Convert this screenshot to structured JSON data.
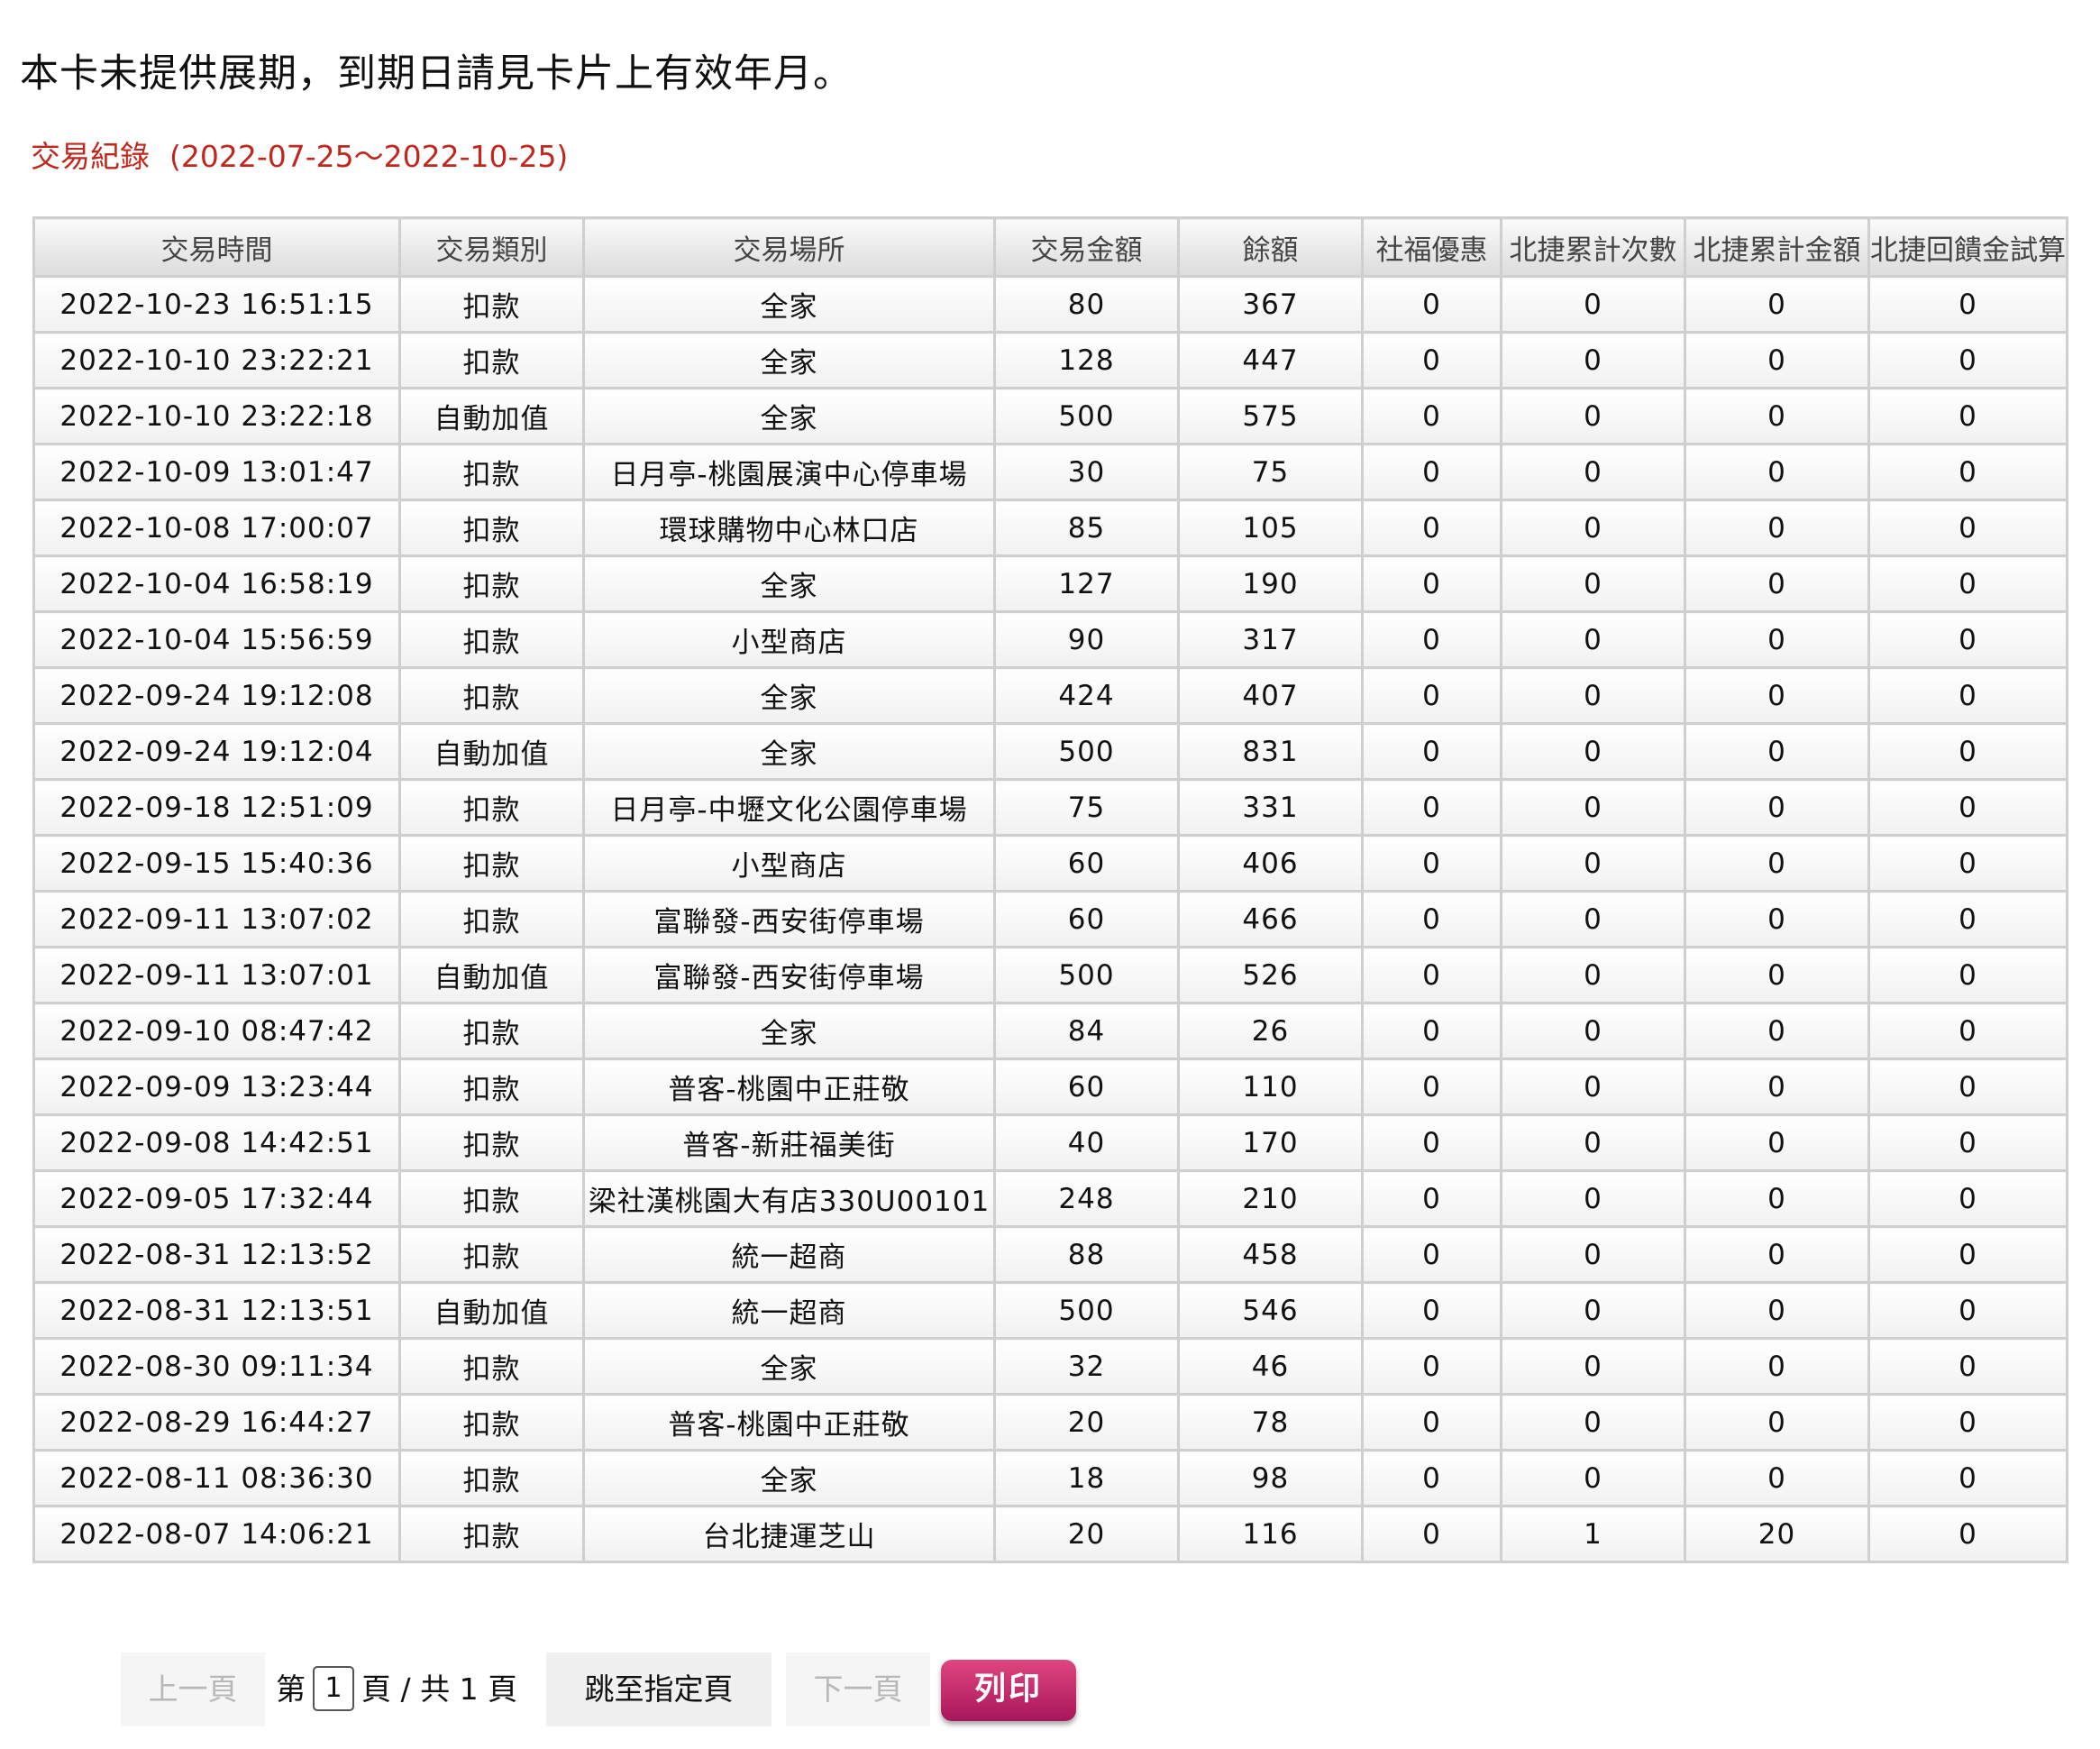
{
  "notice": "本卡未提供展期，到期日請見卡片上有效年月。",
  "record_title": {
    "label": "交易紀錄",
    "range": "(2022-07-25～2022-10-25)"
  },
  "table": {
    "headers": [
      "交易時間",
      "交易類別",
      "交易場所",
      "交易金額",
      "餘額",
      "社福優惠",
      "北捷累計次數",
      "北捷累計金額",
      "北捷回饋金試算"
    ],
    "rows": [
      [
        "2022-10-23 16:51:15",
        "扣款",
        "全家",
        "80",
        "367",
        "0",
        "0",
        "0",
        "0"
      ],
      [
        "2022-10-10 23:22:21",
        "扣款",
        "全家",
        "128",
        "447",
        "0",
        "0",
        "0",
        "0"
      ],
      [
        "2022-10-10 23:22:18",
        "自動加值",
        "全家",
        "500",
        "575",
        "0",
        "0",
        "0",
        "0"
      ],
      [
        "2022-10-09 13:01:47",
        "扣款",
        "日月亭-桃園展演中心停車場",
        "30",
        "75",
        "0",
        "0",
        "0",
        "0"
      ],
      [
        "2022-10-08 17:00:07",
        "扣款",
        "環球購物中心林口店",
        "85",
        "105",
        "0",
        "0",
        "0",
        "0"
      ],
      [
        "2022-10-04 16:58:19",
        "扣款",
        "全家",
        "127",
        "190",
        "0",
        "0",
        "0",
        "0"
      ],
      [
        "2022-10-04 15:56:59",
        "扣款",
        "小型商店",
        "90",
        "317",
        "0",
        "0",
        "0",
        "0"
      ],
      [
        "2022-09-24 19:12:08",
        "扣款",
        "全家",
        "424",
        "407",
        "0",
        "0",
        "0",
        "0"
      ],
      [
        "2022-09-24 19:12:04",
        "自動加值",
        "全家",
        "500",
        "831",
        "0",
        "0",
        "0",
        "0"
      ],
      [
        "2022-09-18 12:51:09",
        "扣款",
        "日月亭-中壢文化公園停車場",
        "75",
        "331",
        "0",
        "0",
        "0",
        "0"
      ],
      [
        "2022-09-15 15:40:36",
        "扣款",
        "小型商店",
        "60",
        "406",
        "0",
        "0",
        "0",
        "0"
      ],
      [
        "2022-09-11 13:07:02",
        "扣款",
        "富聯發-西安街停車場",
        "60",
        "466",
        "0",
        "0",
        "0",
        "0"
      ],
      [
        "2022-09-11 13:07:01",
        "自動加值",
        "富聯發-西安街停車場",
        "500",
        "526",
        "0",
        "0",
        "0",
        "0"
      ],
      [
        "2022-09-10 08:47:42",
        "扣款",
        "全家",
        "84",
        "26",
        "0",
        "0",
        "0",
        "0"
      ],
      [
        "2022-09-09 13:23:44",
        "扣款",
        "普客-桃園中正莊敬",
        "60",
        "110",
        "0",
        "0",
        "0",
        "0"
      ],
      [
        "2022-09-08 14:42:51",
        "扣款",
        "普客-新莊福美街",
        "40",
        "170",
        "0",
        "0",
        "0",
        "0"
      ],
      [
        "2022-09-05 17:32:44",
        "扣款",
        "梁社漢桃園大有店330U00101",
        "248",
        "210",
        "0",
        "0",
        "0",
        "0"
      ],
      [
        "2022-08-31 12:13:52",
        "扣款",
        "統一超商",
        "88",
        "458",
        "0",
        "0",
        "0",
        "0"
      ],
      [
        "2022-08-31 12:13:51",
        "自動加值",
        "統一超商",
        "500",
        "546",
        "0",
        "0",
        "0",
        "0"
      ],
      [
        "2022-08-30 09:11:34",
        "扣款",
        "全家",
        "32",
        "46",
        "0",
        "0",
        "0",
        "0"
      ],
      [
        "2022-08-29 16:44:27",
        "扣款",
        "普客-桃園中正莊敬",
        "20",
        "78",
        "0",
        "0",
        "0",
        "0"
      ],
      [
        "2022-08-11 08:36:30",
        "扣款",
        "全家",
        "18",
        "98",
        "0",
        "0",
        "0",
        "0"
      ],
      [
        "2022-08-07 14:06:21",
        "扣款",
        "台北捷運芝山",
        "20",
        "116",
        "0",
        "1",
        "20",
        "0"
      ]
    ]
  },
  "pager": {
    "prev_label": "上一頁",
    "page_prefix": "第",
    "current_page": "1",
    "page_mid": "頁 / 共",
    "total_pages": "1",
    "page_suffix": "頁",
    "jump_label": "跳至指定頁",
    "next_label": "下一頁",
    "print_label": "列印"
  },
  "colors": {
    "title_red": "#c0281d",
    "print_button": "#c02a6e"
  }
}
